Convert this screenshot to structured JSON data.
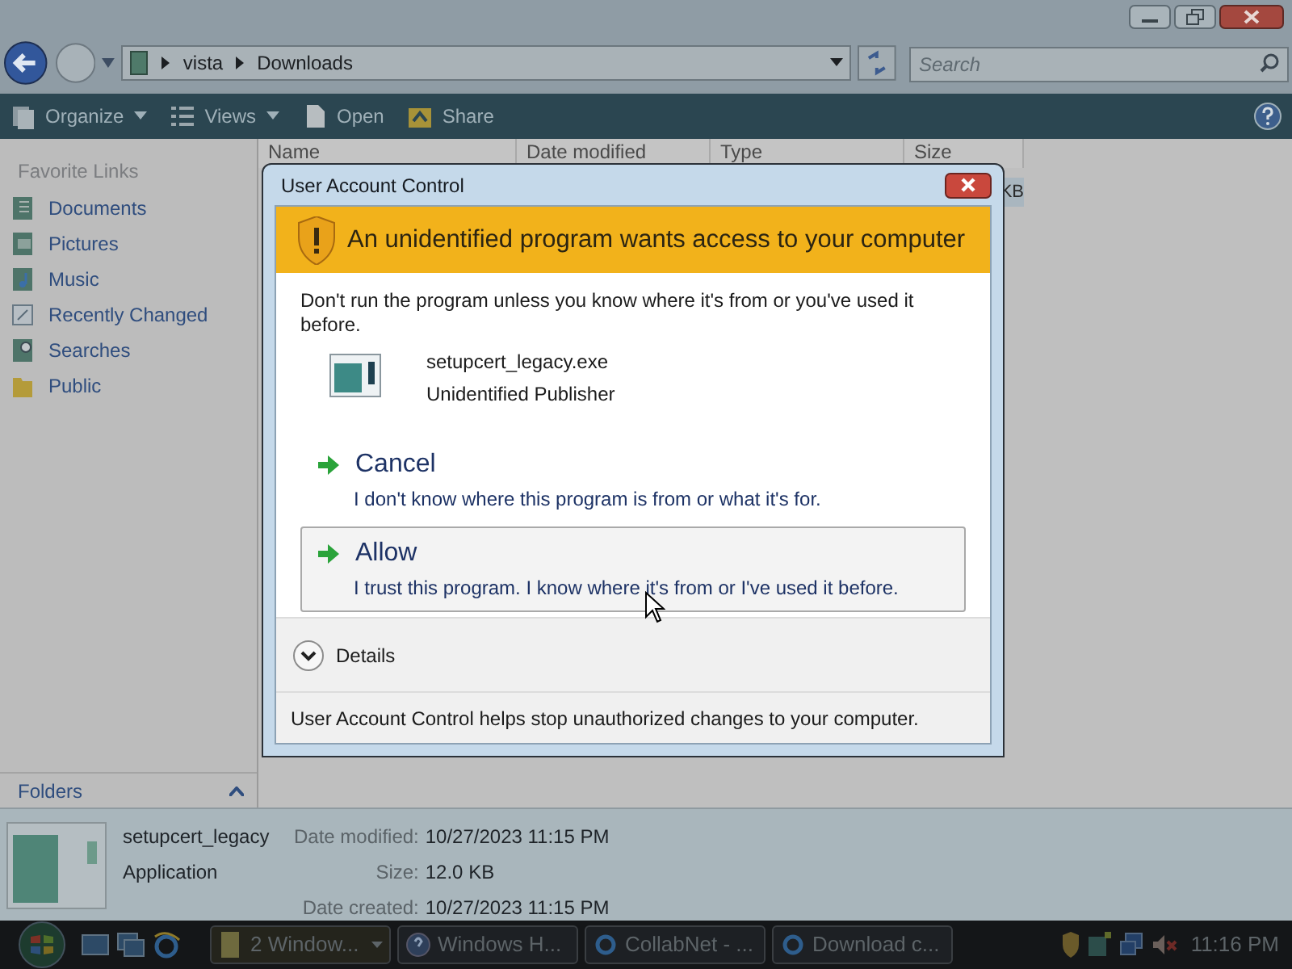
{
  "address_bar": {
    "path": [
      "vista",
      "Downloads"
    ]
  },
  "search": {
    "placeholder": "Search"
  },
  "toolbar": [
    {
      "label": "Organize",
      "menu": true
    },
    {
      "label": "Views",
      "menu": true
    },
    {
      "label": "Open",
      "menu": false
    },
    {
      "label": "Share",
      "menu": false
    }
  ],
  "sidebar": {
    "title": "Favorite Links",
    "items": [
      "Documents",
      "Pictures",
      "Music",
      "Recently Changed",
      "Searches",
      "Public"
    ],
    "folders": "Folders"
  },
  "file_list": {
    "columns": [
      "Name",
      "Date modified",
      "Type",
      "Size"
    ],
    "rows": [
      {
        "size": "KB"
      }
    ]
  },
  "details_pane": {
    "name": "setupcert_legacy",
    "type": "Application",
    "fields": [
      {
        "label": "Date modified:",
        "value": "10/27/2023 11:15 PM"
      },
      {
        "label": "Size:",
        "value": "12.0 KB"
      },
      {
        "label": "Date created:",
        "value": "10/27/2023 11:15 PM"
      }
    ]
  },
  "taskbar": {
    "buttons": [
      {
        "label": "2 Window...",
        "kind": "group"
      },
      {
        "label": "Windows H...",
        "kind": "help"
      },
      {
        "label": "CollabNet - ...",
        "kind": "browser"
      },
      {
        "label": "Download c...",
        "kind": "browser"
      }
    ],
    "clock": "11:16 PM"
  },
  "dialog": {
    "title": "User Account Control",
    "banner": "An unidentified program wants access to your computer",
    "message": "Don't run the program unless you know where it's from or you've used it before.",
    "program": {
      "name": "setupcert_legacy.exe",
      "publisher": "Unidentified Publisher"
    },
    "options": [
      {
        "title": "Cancel",
        "description": "I don't know where this program is from or what it's for.",
        "hovered": false
      },
      {
        "title": "Allow",
        "description": "I trust this program. I know where it's from or I've used it before.",
        "hovered": true
      }
    ],
    "details": {
      "label": "Details",
      "expanded": false
    },
    "footer": "User Account Control helps stop unauthorized changes to your computer."
  }
}
